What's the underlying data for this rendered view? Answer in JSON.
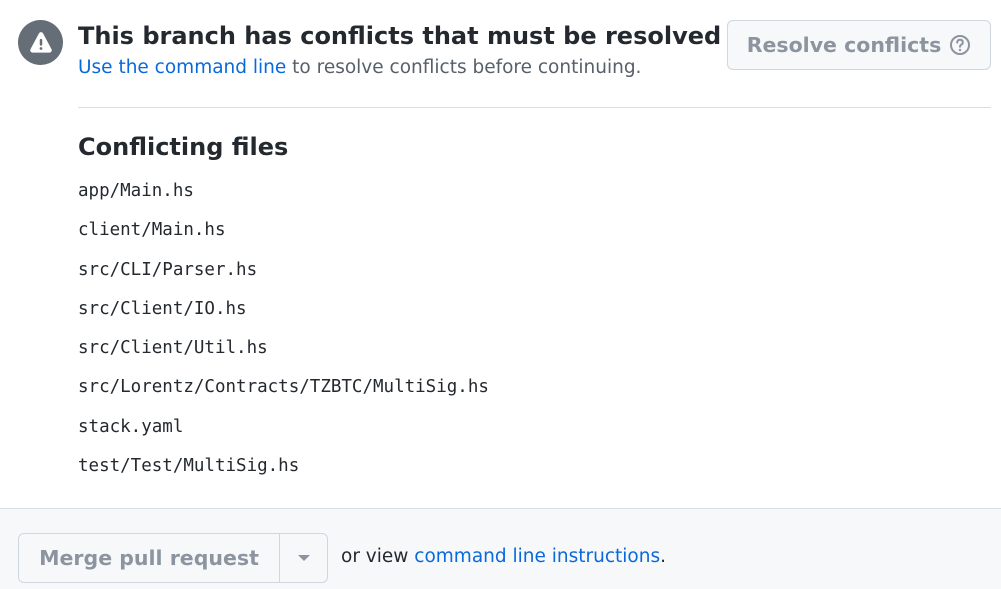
{
  "alert": {
    "icon": "alert-icon",
    "title": "This branch has conflicts that must be resolved",
    "link_text": "Use the command line",
    "subtitle_rest": " to resolve conflicts before continuing.",
    "resolve_button_label": "Resolve conflicts",
    "help_icon": "question-circle-icon"
  },
  "conflicts": {
    "heading": "Conflicting files",
    "files": [
      "app/Main.hs",
      "client/Main.hs",
      "src/CLI/Parser.hs",
      "src/Client/IO.hs",
      "src/Client/Util.hs",
      "src/Lorentz/Contracts/TZBTC/MultiSig.hs",
      "stack.yaml",
      "test/Test/MultiSig.hs"
    ]
  },
  "footer": {
    "merge_button_label": "Merge pull request",
    "dropdown_icon": "caret-down-icon",
    "prefix_text": "or view ",
    "link_text": "command line instructions",
    "suffix_text": "."
  },
  "colors": {
    "link": "#0969da",
    "disabled_text": "#8c959f",
    "badge": "#656d76"
  }
}
